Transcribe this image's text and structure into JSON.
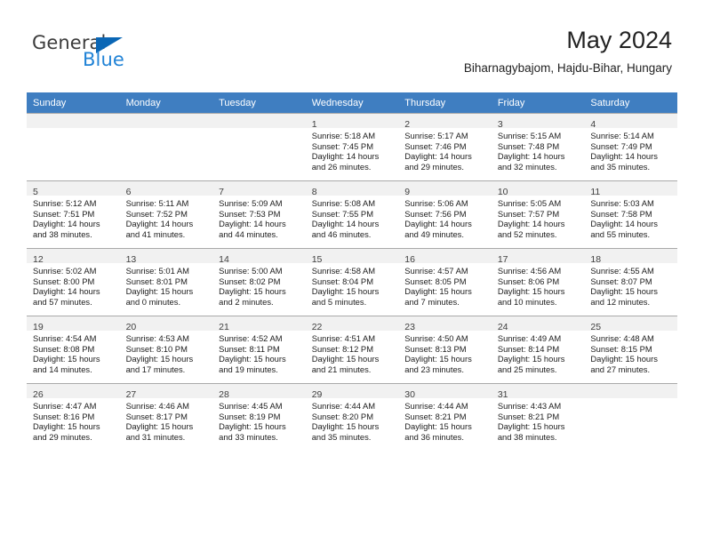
{
  "brand": {
    "name_top": "General",
    "name_bottom": "Blue",
    "triangle_color": "#0a66b5",
    "blue_text_color": "#2183d6"
  },
  "header": {
    "month_title": "May 2024",
    "location": "Biharnagybajom, Hajdu-Bihar, Hungary"
  },
  "theme": {
    "header_blue": "#3f7ec1",
    "daynum_strip": "#f1f1f1",
    "grid_line": "#a9a9a9"
  },
  "weekdays": [
    "Sunday",
    "Monday",
    "Tuesday",
    "Wednesday",
    "Thursday",
    "Friday",
    "Saturday"
  ],
  "labels": {
    "sunrise": "Sunrise:",
    "sunset": "Sunset:",
    "daylight": "Daylight:"
  },
  "weeks": [
    [
      {
        "day": "",
        "blank": true
      },
      {
        "day": "",
        "blank": true
      },
      {
        "day": "",
        "blank": true
      },
      {
        "day": "1",
        "sunrise": "Sunrise: 5:18 AM",
        "sunset": "Sunset: 7:45 PM",
        "daylight": "Daylight: 14 hours and 26 minutes."
      },
      {
        "day": "2",
        "sunrise": "Sunrise: 5:17 AM",
        "sunset": "Sunset: 7:46 PM",
        "daylight": "Daylight: 14 hours and 29 minutes."
      },
      {
        "day": "3",
        "sunrise": "Sunrise: 5:15 AM",
        "sunset": "Sunset: 7:48 PM",
        "daylight": "Daylight: 14 hours and 32 minutes."
      },
      {
        "day": "4",
        "sunrise": "Sunrise: 5:14 AM",
        "sunset": "Sunset: 7:49 PM",
        "daylight": "Daylight: 14 hours and 35 minutes."
      }
    ],
    [
      {
        "day": "5",
        "sunrise": "Sunrise: 5:12 AM",
        "sunset": "Sunset: 7:51 PM",
        "daylight": "Daylight: 14 hours and 38 minutes."
      },
      {
        "day": "6",
        "sunrise": "Sunrise: 5:11 AM",
        "sunset": "Sunset: 7:52 PM",
        "daylight": "Daylight: 14 hours and 41 minutes."
      },
      {
        "day": "7",
        "sunrise": "Sunrise: 5:09 AM",
        "sunset": "Sunset: 7:53 PM",
        "daylight": "Daylight: 14 hours and 44 minutes."
      },
      {
        "day": "8",
        "sunrise": "Sunrise: 5:08 AM",
        "sunset": "Sunset: 7:55 PM",
        "daylight": "Daylight: 14 hours and 46 minutes."
      },
      {
        "day": "9",
        "sunrise": "Sunrise: 5:06 AM",
        "sunset": "Sunset: 7:56 PM",
        "daylight": "Daylight: 14 hours and 49 minutes."
      },
      {
        "day": "10",
        "sunrise": "Sunrise: 5:05 AM",
        "sunset": "Sunset: 7:57 PM",
        "daylight": "Daylight: 14 hours and 52 minutes."
      },
      {
        "day": "11",
        "sunrise": "Sunrise: 5:03 AM",
        "sunset": "Sunset: 7:58 PM",
        "daylight": "Daylight: 14 hours and 55 minutes."
      }
    ],
    [
      {
        "day": "12",
        "sunrise": "Sunrise: 5:02 AM",
        "sunset": "Sunset: 8:00 PM",
        "daylight": "Daylight: 14 hours and 57 minutes."
      },
      {
        "day": "13",
        "sunrise": "Sunrise: 5:01 AM",
        "sunset": "Sunset: 8:01 PM",
        "daylight": "Daylight: 15 hours and 0 minutes."
      },
      {
        "day": "14",
        "sunrise": "Sunrise: 5:00 AM",
        "sunset": "Sunset: 8:02 PM",
        "daylight": "Daylight: 15 hours and 2 minutes."
      },
      {
        "day": "15",
        "sunrise": "Sunrise: 4:58 AM",
        "sunset": "Sunset: 8:04 PM",
        "daylight": "Daylight: 15 hours and 5 minutes."
      },
      {
        "day": "16",
        "sunrise": "Sunrise: 4:57 AM",
        "sunset": "Sunset: 8:05 PM",
        "daylight": "Daylight: 15 hours and 7 minutes."
      },
      {
        "day": "17",
        "sunrise": "Sunrise: 4:56 AM",
        "sunset": "Sunset: 8:06 PM",
        "daylight": "Daylight: 15 hours and 10 minutes."
      },
      {
        "day": "18",
        "sunrise": "Sunrise: 4:55 AM",
        "sunset": "Sunset: 8:07 PM",
        "daylight": "Daylight: 15 hours and 12 minutes."
      }
    ],
    [
      {
        "day": "19",
        "sunrise": "Sunrise: 4:54 AM",
        "sunset": "Sunset: 8:08 PM",
        "daylight": "Daylight: 15 hours and 14 minutes."
      },
      {
        "day": "20",
        "sunrise": "Sunrise: 4:53 AM",
        "sunset": "Sunset: 8:10 PM",
        "daylight": "Daylight: 15 hours and 17 minutes."
      },
      {
        "day": "21",
        "sunrise": "Sunrise: 4:52 AM",
        "sunset": "Sunset: 8:11 PM",
        "daylight": "Daylight: 15 hours and 19 minutes."
      },
      {
        "day": "22",
        "sunrise": "Sunrise: 4:51 AM",
        "sunset": "Sunset: 8:12 PM",
        "daylight": "Daylight: 15 hours and 21 minutes."
      },
      {
        "day": "23",
        "sunrise": "Sunrise: 4:50 AM",
        "sunset": "Sunset: 8:13 PM",
        "daylight": "Daylight: 15 hours and 23 minutes."
      },
      {
        "day": "24",
        "sunrise": "Sunrise: 4:49 AM",
        "sunset": "Sunset: 8:14 PM",
        "daylight": "Daylight: 15 hours and 25 minutes."
      },
      {
        "day": "25",
        "sunrise": "Sunrise: 4:48 AM",
        "sunset": "Sunset: 8:15 PM",
        "daylight": "Daylight: 15 hours and 27 minutes."
      }
    ],
    [
      {
        "day": "26",
        "sunrise": "Sunrise: 4:47 AM",
        "sunset": "Sunset: 8:16 PM",
        "daylight": "Daylight: 15 hours and 29 minutes."
      },
      {
        "day": "27",
        "sunrise": "Sunrise: 4:46 AM",
        "sunset": "Sunset: 8:17 PM",
        "daylight": "Daylight: 15 hours and 31 minutes."
      },
      {
        "day": "28",
        "sunrise": "Sunrise: 4:45 AM",
        "sunset": "Sunset: 8:19 PM",
        "daylight": "Daylight: 15 hours and 33 minutes."
      },
      {
        "day": "29",
        "sunrise": "Sunrise: 4:44 AM",
        "sunset": "Sunset: 8:20 PM",
        "daylight": "Daylight: 15 hours and 35 minutes."
      },
      {
        "day": "30",
        "sunrise": "Sunrise: 4:44 AM",
        "sunset": "Sunset: 8:21 PM",
        "daylight": "Daylight: 15 hours and 36 minutes."
      },
      {
        "day": "31",
        "sunrise": "Sunrise: 4:43 AM",
        "sunset": "Sunset: 8:21 PM",
        "daylight": "Daylight: 15 hours and 38 minutes."
      },
      {
        "day": "",
        "blank": true
      }
    ]
  ]
}
